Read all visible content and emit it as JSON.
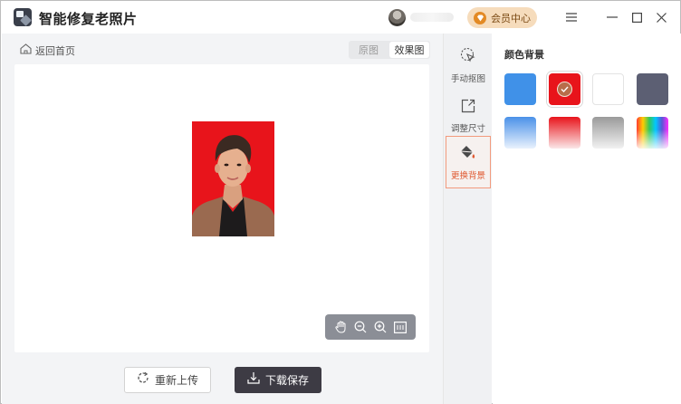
{
  "app": {
    "title": "智能修复老照片"
  },
  "header": {
    "vip_label": "会员中心"
  },
  "editor": {
    "back_label": "返回首页",
    "view_toggle": {
      "original_label": "原图",
      "result_label": "效果图",
      "selected": "效果图"
    },
    "actions": {
      "reupload_label": "重新上传",
      "download_label": "下载保存"
    },
    "zoom_tools": [
      "hand-icon",
      "zoom-out-icon",
      "zoom-in-icon",
      "fit-screen-icon"
    ]
  },
  "tools": [
    {
      "label": "手动抠图",
      "icon": "cursor-select-icon",
      "active": false
    },
    {
      "label": "调整尺寸",
      "icon": "resize-icon",
      "active": false
    },
    {
      "label": "更换背景",
      "icon": "paint-bucket-icon",
      "active": true
    }
  ],
  "background_panel": {
    "title": "颜色背景",
    "selected_index": 1,
    "swatches": [
      {
        "kind": "solid",
        "colors": [
          "#4091e8"
        ]
      },
      {
        "kind": "solid",
        "colors": [
          "#e8141b"
        ]
      },
      {
        "kind": "solid",
        "colors": [
          "#ffffff"
        ]
      },
      {
        "kind": "solid",
        "colors": [
          "#5c5f73"
        ]
      },
      {
        "kind": "gradient",
        "colors": [
          "#4a91e8",
          "#e9f2fd"
        ]
      },
      {
        "kind": "gradient",
        "colors": [
          "#e8141b",
          "#fbe7e8"
        ]
      },
      {
        "kind": "gradient",
        "colors": [
          "#9a9a9a",
          "#f2f2f2"
        ]
      },
      {
        "kind": "rainbow",
        "colors": [
          "#ff3b30",
          "#ffcc00",
          "#34c759",
          "#00c7ff",
          "#5856d6",
          "#ff2dff"
        ]
      }
    ]
  },
  "colors": {
    "accent": "#e05a32",
    "photo_background": "#e8141b",
    "dark_button": "#3d3b44"
  }
}
